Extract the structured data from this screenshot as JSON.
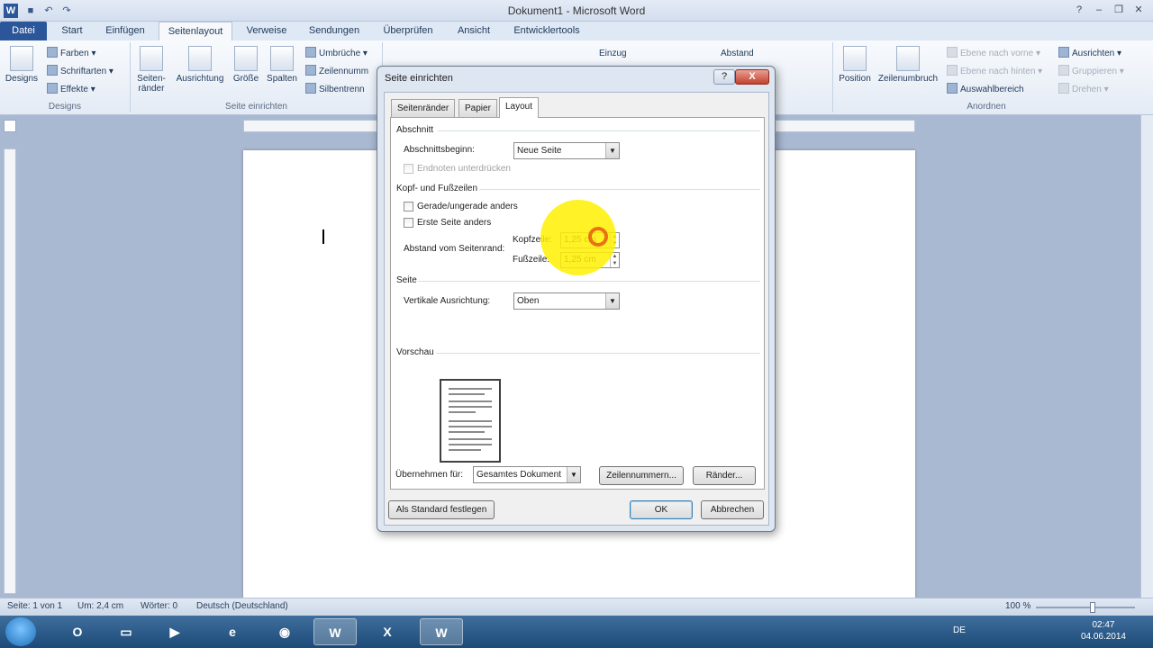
{
  "window": {
    "title": "Dokument1 - Microsoft Word",
    "app_icon": "W"
  },
  "tabs": [
    "Datei",
    "Start",
    "Einfügen",
    "Seitenlayout",
    "Verweise",
    "Sendungen",
    "Überprüfen",
    "Ansicht",
    "Entwicklertools"
  ],
  "ribbon": {
    "designs": {
      "big": "Designs",
      "farben": "Farben",
      "schriftarten": "Schriftarten",
      "effekte": "Effekte",
      "label": "Designs"
    },
    "seite": {
      "seitenraender": "Seiten- ränder",
      "ausrichtung": "Ausrichtung",
      "groesse": "Größe",
      "spalten": "Spalten",
      "umbrueche": "Umbrüche",
      "zeilennummern": "Zeilennumm",
      "silbentrennung": "Silbentrenn",
      "label": "Seite einrichten"
    },
    "absatz": {
      "einzug": "Einzug",
      "abstand": "Abstand"
    },
    "anordnen": {
      "position": "Position",
      "zeilenumbruch": "Zeilenumbruch",
      "ebene_vorne": "Ebene nach vorne",
      "ebene_hinten": "Ebene nach hinten",
      "auswahlbereich": "Auswahlbereich",
      "ausrichten": "Ausrichten",
      "gruppieren": "Gruppieren",
      "drehen": "Drehen",
      "label": "Anordnen"
    }
  },
  "dialog": {
    "title": "Seite einrichten",
    "help": "?",
    "close": "X",
    "tabs": [
      "Seitenränder",
      "Papier",
      "Layout"
    ],
    "active_tab": "Layout",
    "abschnitt": {
      "heading": "Abschnitt",
      "beginn_label": "Abschnittsbeginn:",
      "beginn_value": "Neue Seite",
      "endnoten": "Endnoten unterdrücken"
    },
    "kopf": {
      "heading": "Kopf- und Fußzeilen",
      "gerade": "Gerade/ungerade anders",
      "erste": "Erste Seite anders",
      "abstand_label": "Abstand vom Seitenrand:",
      "kopfzeile_label": "Kopfzeile:",
      "kopfzeile_value": "1,25 cm",
      "fusszeile_label": "Fußzeile:",
      "fusszeile_value": "1,25 cm"
    },
    "seite": {
      "heading": "Seite",
      "vertikal_label": "Vertikale Ausrichtung:",
      "vertikal_value": "Oben"
    },
    "vorschau": {
      "heading": "Vorschau"
    },
    "uebernehmen_label": "Übernehmen für:",
    "uebernehmen_value": "Gesamtes Dokument",
    "zeilennummern_btn": "Zeilennummern...",
    "raender_btn": "Ränder...",
    "standard_btn": "Als Standard festlegen",
    "ok_btn": "OK",
    "abbrechen_btn": "Abbrechen"
  },
  "statusbar": {
    "seite": "Seite: 1 von 1",
    "um": "Um: 2,4 cm",
    "woerter": "Wörter: 0",
    "sprache": "Deutsch (Deutschland)",
    "zoom": "100 %"
  },
  "taskbar": {
    "lang": "DE",
    "time": "02:47",
    "date": "04.06.2014"
  },
  "colors": {
    "accent": "#2b579a",
    "highlight": "#fff000"
  }
}
